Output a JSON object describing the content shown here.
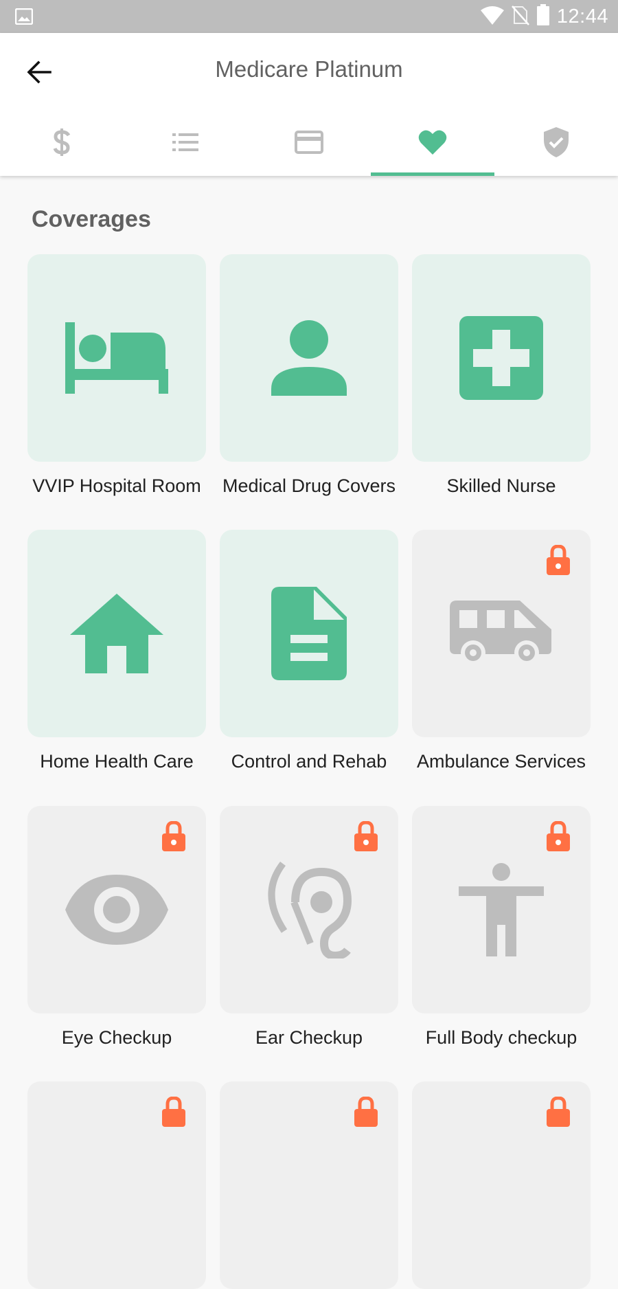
{
  "status_bar": {
    "time": "12:44"
  },
  "header": {
    "title": "Medicare Platinum"
  },
  "tabs": [
    {
      "icon": "dollar-icon",
      "selected": false
    },
    {
      "icon": "list-icon",
      "selected": false
    },
    {
      "icon": "credit-card-icon",
      "selected": false
    },
    {
      "icon": "heart-icon",
      "selected": true
    },
    {
      "icon": "shield-check-icon",
      "selected": false
    }
  ],
  "section": {
    "title": "Coverages"
  },
  "coverages": [
    {
      "label": "VVIP Hospital Room",
      "icon": "bed-icon",
      "locked": false
    },
    {
      "label": "Medical Drug Covers",
      "icon": "person-icon",
      "locked": false
    },
    {
      "label": "Skilled Nurse",
      "icon": "medical-cross-icon",
      "locked": false
    },
    {
      "label": "Home Health Care",
      "icon": "home-icon",
      "locked": false
    },
    {
      "label": "Control and Rehab",
      "icon": "document-icon",
      "locked": false
    },
    {
      "label": "Ambulance Services",
      "icon": "van-icon",
      "locked": true
    },
    {
      "label": "Eye Checkup",
      "icon": "eye-icon",
      "locked": true
    },
    {
      "label": "Ear Checkup",
      "icon": "ear-icon",
      "locked": true
    },
    {
      "label": "Full Body checkup",
      "icon": "body-icon",
      "locked": true
    }
  ],
  "colors": {
    "accent": "#52bd91",
    "locked_icon": "#bdbdbd",
    "lock": "#ff7043",
    "active_card": "#e5f2ed",
    "locked_card": "#efefef"
  }
}
